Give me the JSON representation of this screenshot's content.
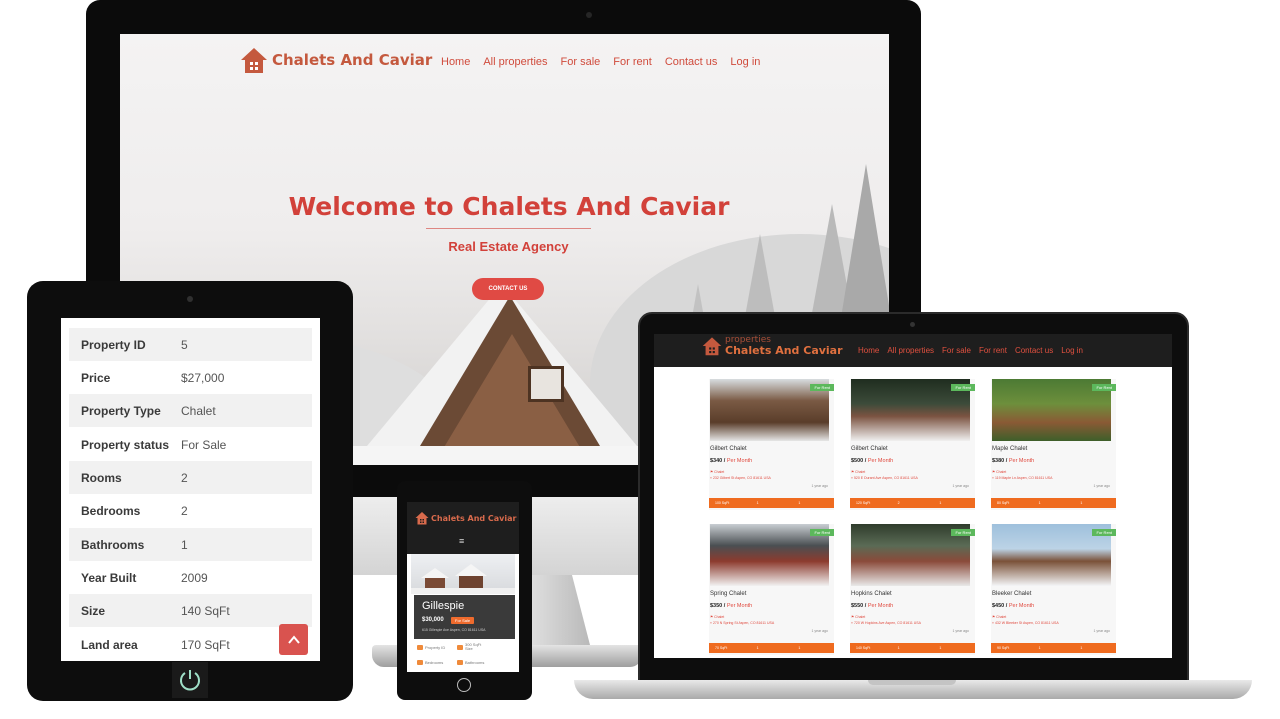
{
  "desktop": {
    "logo_text": "Chalets And Caviar",
    "menu": [
      "Home",
      "All properties",
      "For sale",
      "For rent",
      "Contact us",
      "Log in"
    ],
    "hero_title": "Welcome to Chalets And Caviar",
    "hero_subtitle": "Real Estate Agency",
    "cta_label": "CONTACT US"
  },
  "tablet": {
    "details": [
      {
        "key": "Property ID",
        "value": "5"
      },
      {
        "key": "Price",
        "value": "$27,000"
      },
      {
        "key": "Property Type",
        "value": "Chalet"
      },
      {
        "key": "Property status",
        "value": "For Sale"
      },
      {
        "key": "Rooms",
        "value": "2"
      },
      {
        "key": "Bedrooms",
        "value": "2"
      },
      {
        "key": "Bathrooms",
        "value": "1"
      },
      {
        "key": "Year Built",
        "value": "2009"
      },
      {
        "key": "Size",
        "value": "140 SqFt"
      },
      {
        "key": "Land area",
        "value": "170 SqFt"
      }
    ],
    "scroll_top_icon": "chevron-up-icon"
  },
  "phone": {
    "logo_text": "Chalets And Caviar",
    "menu_icon": "hamburger-icon",
    "card_title": "Gillespie",
    "card_price": "$30,000",
    "card_badge": "For Sale",
    "card_address": "615 Gillespie Ave Aspen, CO 81611 USA",
    "features": [
      {
        "label": "Property ID",
        "icon": "key-icon"
      },
      {
        "label": "300 SqFt",
        "sub": "Size",
        "icon": "size-icon"
      },
      {
        "label": "Bedrooms",
        "icon": "bed-icon"
      },
      {
        "label": "Bathrooms",
        "icon": "bath-icon"
      }
    ]
  },
  "laptop": {
    "logo_small": "properties",
    "logo_text": "Chalets And Caviar",
    "menu": [
      "Home",
      "All properties",
      "For sale",
      "For rent",
      "Contact us",
      "Log in"
    ],
    "cards": [
      {
        "title": "Gilbert Chalet",
        "price": "$340",
        "period": "Per Month",
        "badge": "For Rent",
        "type": "Chalet",
        "address": "232 Gilbert St Aspen, CO 81611 USA",
        "date": "1 year ago",
        "size": "100 SqFt",
        "beds": "1",
        "baths": "1"
      },
      {
        "title": "Gilbert Chalet",
        "price": "$500",
        "period": "Per Month",
        "badge": "For Rent",
        "type": "Chalet",
        "address": "520 E Durant Ave Aspen, CO 81611 USA",
        "date": "1 year ago",
        "size": "120 SqFt",
        "beds": "2",
        "baths": "1"
      },
      {
        "title": "Maple Chalet",
        "price": "$380",
        "period": "Per Month",
        "badge": "For Rent",
        "type": "Chalet",
        "address": "119 Maple Ln Aspen, CO 81611 USA",
        "date": "1 year ago",
        "size": "80 SqFt",
        "beds": "1",
        "baths": "1"
      },
      {
        "title": "Spring Chalet",
        "price": "$350",
        "period": "Per Month",
        "badge": "For Rent",
        "type": "Chalet",
        "address": "270 N Spring St Aspen, CO 81611 USA",
        "date": "1 year ago",
        "size": "70 SqFt",
        "beds": "1",
        "baths": "1"
      },
      {
        "title": "Hopkins Chalet",
        "price": "$550",
        "period": "Per Month",
        "badge": "For Rent",
        "type": "Chalet",
        "address": "720 W Hopkins Ave Aspen, CO 81611 USA",
        "date": "1 year ago",
        "size": "140 SqFt",
        "beds": "1",
        "baths": "1"
      },
      {
        "title": "Bleeker Chalet",
        "price": "$450",
        "period": "Per Month",
        "badge": "For Rent",
        "type": "Chalet",
        "address": "432 W Bleeker St Aspen, CO 81611 USA",
        "date": "1 year ago",
        "size": "90 SqFt",
        "beds": "1",
        "baths": "1"
      }
    ]
  },
  "colors": {
    "brand": "#d2413a",
    "logo": "#c4593e",
    "accent_orange": "#ef6b1f",
    "badge_green": "#5cb85c"
  }
}
